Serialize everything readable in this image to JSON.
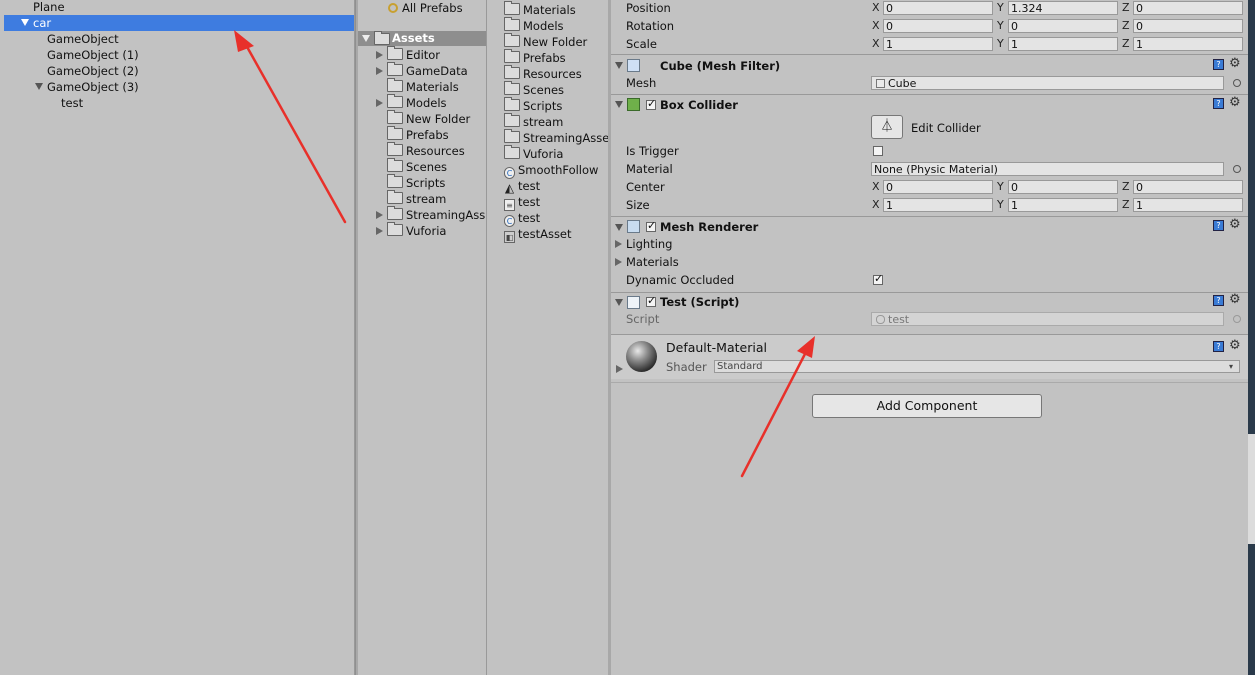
{
  "hierarchy": {
    "items": [
      {
        "label": "Plane"
      },
      {
        "label": "car"
      },
      {
        "label": "GameObject"
      },
      {
        "label": "GameObject (1)"
      },
      {
        "label": "GameObject (2)"
      },
      {
        "label": "GameObject (3)"
      },
      {
        "label": "test"
      }
    ]
  },
  "project": {
    "all_prefabs": "All Prefabs",
    "assets_label": "Assets",
    "folders": [
      "Editor",
      "GameData",
      "Materials",
      "Models",
      "New Folder",
      "Prefabs",
      "Resources",
      "Scenes",
      "Scripts",
      "stream",
      "StreamingAss",
      "Vuforia"
    ],
    "files": [
      {
        "label": "Materials",
        "icon": "folder-icon"
      },
      {
        "label": "Models",
        "icon": "folder-icon"
      },
      {
        "label": "New Folder",
        "icon": "folder-icon"
      },
      {
        "label": "Prefabs",
        "icon": "folder-icon"
      },
      {
        "label": "Resources",
        "icon": "folder-icon"
      },
      {
        "label": "Scenes",
        "icon": "folder-icon"
      },
      {
        "label": "Scripts",
        "icon": "folder-icon"
      },
      {
        "label": "stream",
        "icon": "folder-icon"
      },
      {
        "label": "StreamingAsse",
        "icon": "folder-icon"
      },
      {
        "label": "Vuforia",
        "icon": "folder-icon"
      },
      {
        "label": "SmoothFollow",
        "icon": "csharp-script-icon"
      },
      {
        "label": "test",
        "icon": "unity-scene-icon"
      },
      {
        "label": "test",
        "icon": "text-file-icon"
      },
      {
        "label": "test",
        "icon": "csharp-script-icon"
      },
      {
        "label": "testAsset",
        "icon": "asset-file-icon"
      }
    ]
  },
  "inspector": {
    "transform": {
      "position_label": "Position",
      "rotation_label": "Rotation",
      "scale_label": "Scale",
      "position": {
        "x": "0",
        "y": "1.324",
        "z": "0"
      },
      "rotation": {
        "x": "0",
        "y": "0",
        "z": "0"
      },
      "scale": {
        "x": "1",
        "y": "1",
        "z": "1"
      }
    },
    "axes": {
      "x": "X",
      "y": "Y",
      "z": "Z"
    },
    "mesh_filter": {
      "title": "Cube (Mesh Filter)",
      "mesh_label": "Mesh",
      "mesh_value": "Cube"
    },
    "box_collider": {
      "title": "Box Collider",
      "edit_collider": "Edit Collider",
      "is_trigger_label": "Is Trigger",
      "material_label": "Material",
      "material_value": "None (Physic Material)",
      "center_label": "Center",
      "center": {
        "x": "0",
        "y": "0",
        "z": "0"
      },
      "size_label": "Size",
      "size": {
        "x": "1",
        "y": "1",
        "z": "1"
      }
    },
    "mesh_renderer": {
      "title": "Mesh Renderer",
      "lighting": "Lighting",
      "materials": "Materials",
      "dynamic_occluded": "Dynamic Occluded"
    },
    "test_script": {
      "title": "Test (Script)",
      "script_label": "Script",
      "script_value": "test"
    },
    "material": {
      "name": "Default-Material",
      "shader_label": "Shader",
      "shader_value": "Standard"
    },
    "add_component": "Add Component"
  },
  "colors": {
    "selection": "#3e7ce0",
    "annotation_arrow": "#e8302a"
  }
}
